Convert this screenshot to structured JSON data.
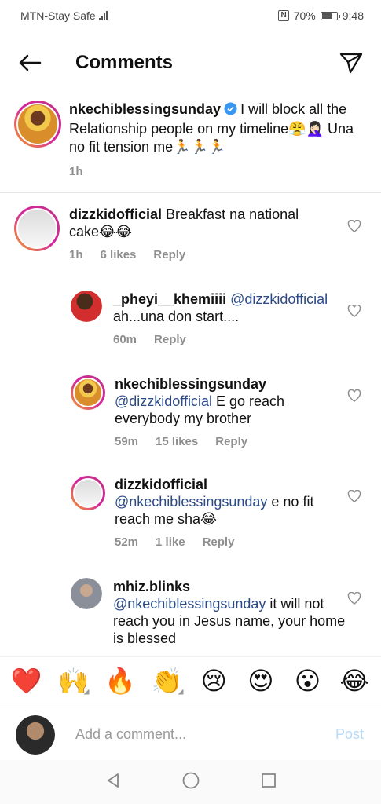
{
  "status_bar": {
    "carrier": "MTN-Stay Safe",
    "battery": "70%",
    "time": "9:48",
    "battery_level": 0.7
  },
  "header": {
    "title": "Comments"
  },
  "caption": {
    "username": "nkechiblessingsunday",
    "text": "I will block all the Relationship people on my timeline😤🤦🏻‍♀️ Una no fit tension me🏃🏃🏃",
    "time": "1h"
  },
  "comments": [
    {
      "username": "dizzkidofficial",
      "mention": "",
      "text": "Breakfast na national cake😂😂",
      "time": "1h",
      "likes": "6 likes",
      "reply": "Reply"
    },
    {
      "username": "_pheyi__khemiiii",
      "mention": "@dizzkidofficial",
      "text": "ah...una don start....",
      "time": "60m",
      "likes": "",
      "reply": "Reply"
    },
    {
      "username": "nkechiblessingsunday",
      "mention": "@dizzkidofficial",
      "text": "E go reach everybody my brother",
      "time": "59m",
      "likes": "15 likes",
      "reply": "Reply"
    },
    {
      "username": "dizzkidofficial",
      "mention": "@nkechiblessingsunday",
      "text": "e no fit reach me sha😂",
      "time": "52m",
      "likes": "1 like",
      "reply": "Reply"
    },
    {
      "username": "mhiz.blinks",
      "mention": "@nkechiblessingsunday",
      "text": "it will not reach you in Jesus name, your home is blessed",
      "time": "",
      "likes": "",
      "reply": ""
    }
  ],
  "emoji_bar": [
    "❤️",
    "🙌",
    "🔥",
    "👏",
    "😢",
    "😍",
    "😮",
    "😂"
  ],
  "add_comment": {
    "placeholder": "Add a comment...",
    "post": "Post"
  },
  "colors": {
    "link": "#2b4a86",
    "post_disabled": "#b6dcf8",
    "meta": "#8e8e8e"
  }
}
